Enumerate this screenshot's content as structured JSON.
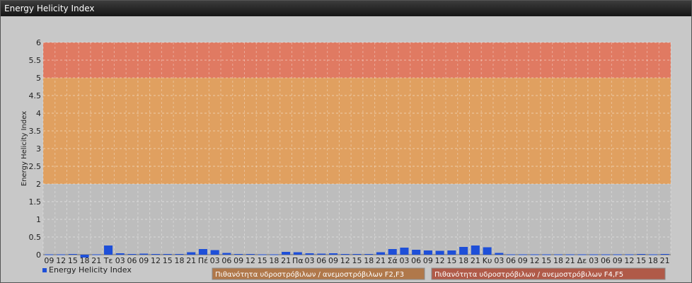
{
  "window": {
    "title": "Energy Helicity Index"
  },
  "chart_data": {
    "type": "bar",
    "title": "",
    "xlabel": "",
    "ylabel": "Energy Helicity Index",
    "ylim": [
      0,
      6
    ],
    "yticks": [
      "0",
      "0.5",
      "1",
      "1.5",
      "2",
      "2.5",
      "3",
      "3.5",
      "4",
      "4.5",
      "5",
      "5.5",
      "6"
    ],
    "grid": true,
    "categories": [
      "09",
      "12",
      "15",
      "18",
      "21",
      "Τε",
      "03",
      "06",
      "09",
      "12",
      "15",
      "18",
      "21",
      "Πέ",
      "03",
      "06",
      "09",
      "12",
      "15",
      "18",
      "21",
      "Πα",
      "03",
      "06",
      "09",
      "12",
      "15",
      "18",
      "21",
      "Σά",
      "03",
      "06",
      "09",
      "12",
      "15",
      "18",
      "21",
      "Κυ",
      "03",
      "06",
      "09",
      "12",
      "15",
      "18",
      "21",
      "Δε",
      "03",
      "06",
      "09",
      "12",
      "15",
      "18",
      "21"
    ],
    "series": [
      {
        "name": "Energy Helicity Index",
        "color": "#1e4fd8",
        "values": [
          0.01,
          0.01,
          0.02,
          -0.08,
          0.01,
          0.26,
          0.04,
          0.02,
          0.03,
          0.02,
          0.02,
          0.02,
          0.07,
          0.16,
          0.13,
          0.05,
          0.02,
          0.02,
          0.01,
          0.01,
          0.08,
          0.07,
          0.04,
          0.03,
          0.04,
          0.02,
          0.02,
          0.02,
          0.07,
          0.16,
          0.2,
          0.14,
          0.12,
          0.11,
          0.12,
          0.22,
          0.26,
          0.21,
          0.05,
          0.01,
          0.01,
          0.01,
          0.01,
          0.01,
          0.01,
          0.01,
          0.01,
          0.01,
          0.01,
          0.01,
          0.02,
          0.01,
          0.02
        ]
      }
    ],
    "bands": [
      {
        "from": 2,
        "to": 5,
        "color": "#e0a060",
        "label": "Πιθανότητα υδροστρόβιλων / ανεμοστρόβιλων F2,F3"
      },
      {
        "from": 5,
        "to": 6,
        "color": "#e07a62",
        "label": "Πιθανότητα υδροστρόβιλων / ανεμοστρόβιλων F4,F5"
      }
    ],
    "legend": "bottom-left"
  }
}
